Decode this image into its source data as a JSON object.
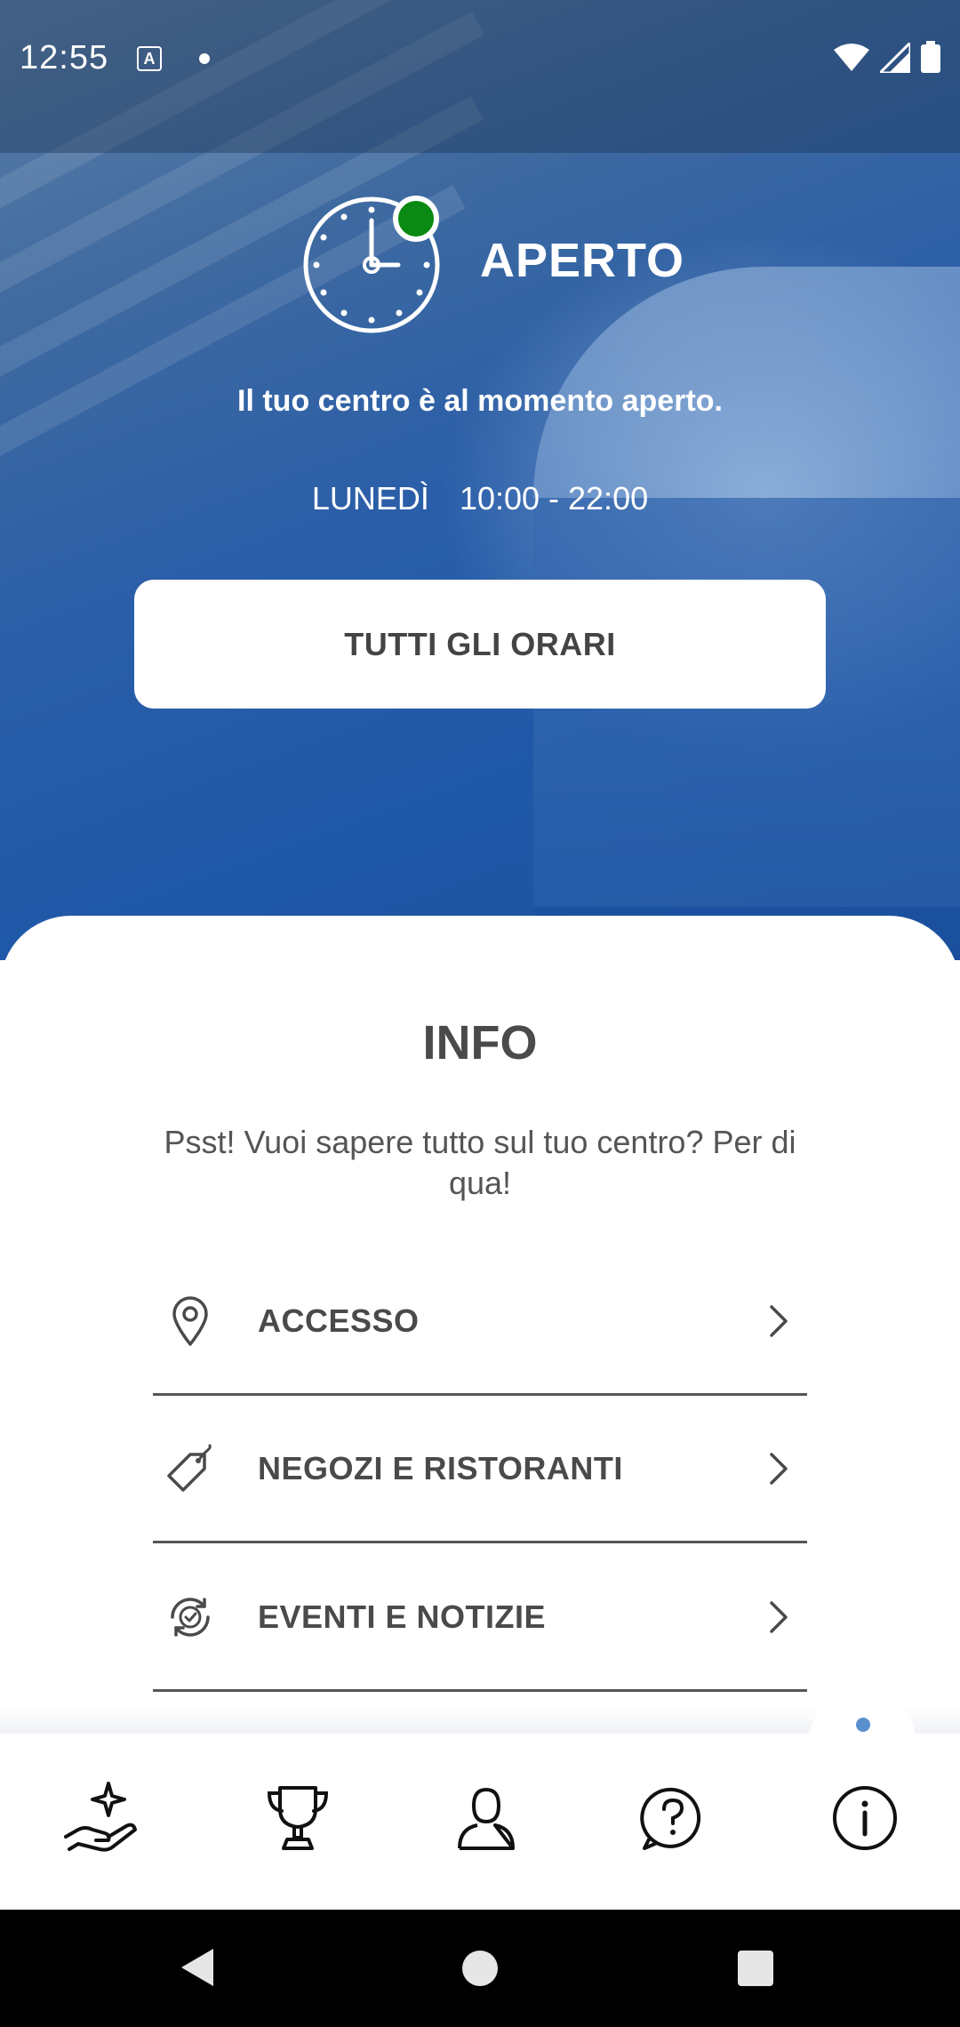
{
  "status_bar": {
    "time": "12:55",
    "notification_icons": [
      "a-icon",
      "dot-icon"
    ],
    "system_icons": [
      "wifi-icon",
      "signal-icon",
      "battery-icon"
    ]
  },
  "hero": {
    "status_title": "APERTO",
    "status_subtitle": "Il tuo centro è al momento aperto.",
    "day": "LUNEDÌ",
    "hours": "10:00 - 22:00",
    "all_hours_button": "TUTTI GLI ORARI",
    "status_color": "#0a8a12"
  },
  "info": {
    "title": "INFO",
    "description": "Psst! Vuoi sapere tutto sul tuo centro? Per di qua!",
    "items": [
      {
        "label": "ACCESSO",
        "icon": "location-pin-icon"
      },
      {
        "label": "NEGOZI E RISTORANTI",
        "icon": "tag-icon"
      },
      {
        "label": "EVENTI E NOTIZIE",
        "icon": "refresh-check-icon"
      }
    ]
  },
  "bottom_nav": {
    "items": [
      {
        "name": "rewards",
        "icon": "hand-sparkle-icon"
      },
      {
        "name": "trophy",
        "icon": "trophy-icon"
      },
      {
        "name": "profile",
        "icon": "user-icon"
      },
      {
        "name": "help",
        "icon": "help-bubble-icon"
      },
      {
        "name": "info",
        "icon": "info-icon",
        "active": true
      }
    ],
    "active_indicator_color": "#5a8fd0"
  }
}
